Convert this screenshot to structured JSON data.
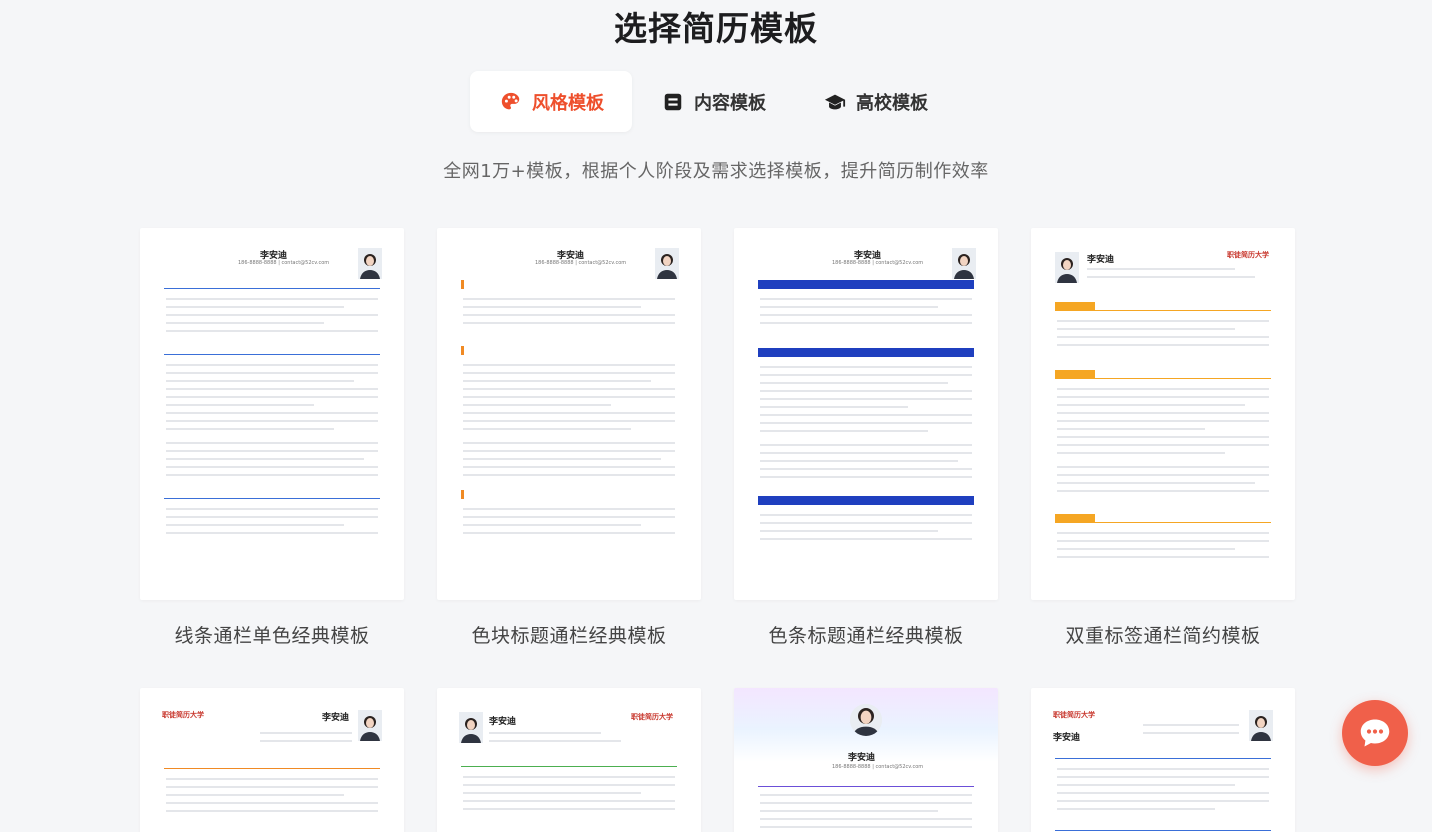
{
  "page": {
    "title": "选择简历模板",
    "subtitle": "全网1万+模板，根据个人阶段及需求选择模板，提升简历制作效率"
  },
  "tabs": [
    {
      "label": "风格模板",
      "icon": "palette-icon",
      "active": true
    },
    {
      "label": "内容模板",
      "icon": "content-icon",
      "active": false
    },
    {
      "label": "高校模板",
      "icon": "graduation-cap-icon",
      "active": false
    }
  ],
  "templates": [
    {
      "label": "线条通栏单色经典模板",
      "accent": "#3a6fd8",
      "style": "line"
    },
    {
      "label": "色块标题通栏经典模板",
      "accent": "#f08a24",
      "style": "block"
    },
    {
      "label": "色条标题通栏经典模板",
      "accent": "#1f3fbf",
      "style": "bar"
    },
    {
      "label": "双重标签通栏简约模板",
      "accent": "#f5a623",
      "style": "tag"
    }
  ],
  "resume_sample": {
    "name": "李安迪",
    "contact": "186-8888-8888 | contact@52cv.com",
    "school": "职徒简历大学"
  },
  "chat": {
    "icon": "chat-bubble-icon"
  },
  "colors": {
    "accent": "#ee4f2c",
    "background": "#f5f6f8"
  }
}
